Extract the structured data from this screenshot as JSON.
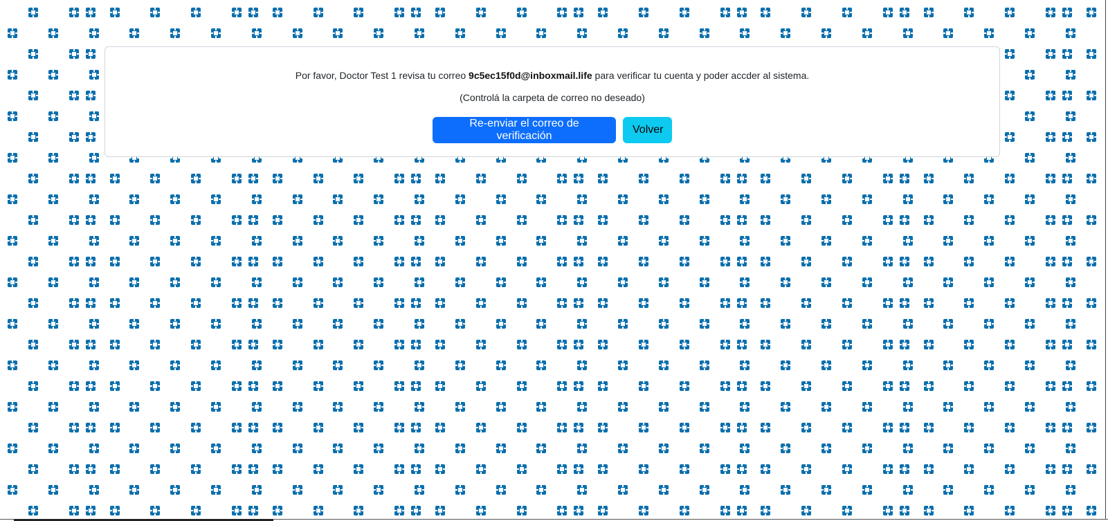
{
  "theme": {
    "pattern_color": "#0b6fad",
    "primary_color": "#0d6efd",
    "info_color": "#0dcaf0"
  },
  "pattern_icon": "medical-cross-icon",
  "verify": {
    "message_prefix": "Por favor, Doctor Test 1 revisa tu correo ",
    "email": "9c5ec15f0d@inboxmail.life",
    "message_suffix": " para verificar tu cuenta y poder accder al sistema.",
    "hint": "(Controlá la carpeta de correo no deseado)",
    "resend_label": "Re-enviar el correo de verificación",
    "back_label": "Volver"
  }
}
